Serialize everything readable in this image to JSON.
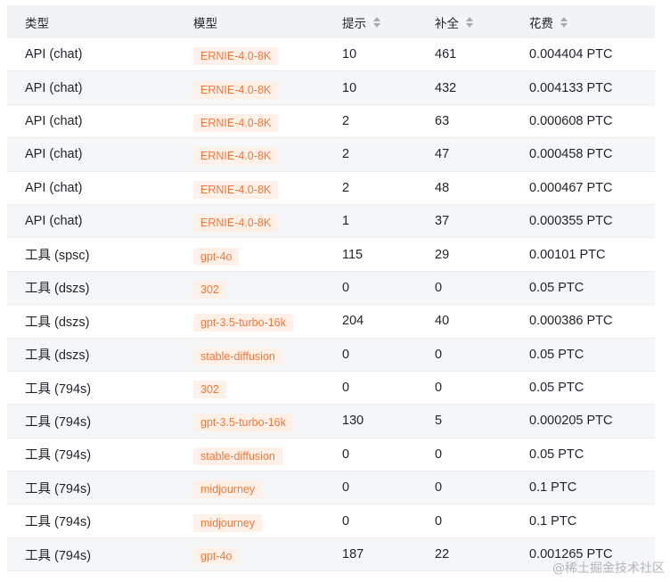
{
  "header": {
    "col_type": "类型",
    "col_model": "模型",
    "col_prompt": "提示",
    "col_completion": "补全",
    "col_cost": "花费"
  },
  "rows": [
    {
      "type": "API (chat)",
      "model": "ERNIE-4.0-8K",
      "prompt": "10",
      "completion": "461",
      "cost": "0.004404 PTC"
    },
    {
      "type": "API (chat)",
      "model": "ERNIE-4.0-8K",
      "prompt": "10",
      "completion": "432",
      "cost": "0.004133 PTC"
    },
    {
      "type": "API (chat)",
      "model": "ERNIE-4.0-8K",
      "prompt": "2",
      "completion": "63",
      "cost": "0.000608 PTC"
    },
    {
      "type": "API (chat)",
      "model": "ERNIE-4.0-8K",
      "prompt": "2",
      "completion": "47",
      "cost": "0.000458 PTC"
    },
    {
      "type": "API (chat)",
      "model": "ERNIE-4.0-8K",
      "prompt": "2",
      "completion": "48",
      "cost": "0.000467 PTC"
    },
    {
      "type": "API (chat)",
      "model": "ERNIE-4.0-8K",
      "prompt": "1",
      "completion": "37",
      "cost": "0.000355 PTC"
    },
    {
      "type": "工具 (spsc)",
      "model": "gpt-4o",
      "prompt": "115",
      "completion": "29",
      "cost": "0.00101 PTC"
    },
    {
      "type": "工具 (dszs)",
      "model": "302",
      "prompt": "0",
      "completion": "0",
      "cost": "0.05 PTC"
    },
    {
      "type": "工具 (dszs)",
      "model": "gpt-3.5-turbo-16k",
      "prompt": "204",
      "completion": "40",
      "cost": "0.000386 PTC"
    },
    {
      "type": "工具 (dszs)",
      "model": "stable-diffusion",
      "prompt": "0",
      "completion": "0",
      "cost": "0.05 PTC"
    },
    {
      "type": "工具 (794s)",
      "model": "302",
      "prompt": "0",
      "completion": "0",
      "cost": "0.05 PTC"
    },
    {
      "type": "工具 (794s)",
      "model": "gpt-3.5-turbo-16k",
      "prompt": "130",
      "completion": "5",
      "cost": "0.000205 PTC"
    },
    {
      "type": "工具 (794s)",
      "model": "stable-diffusion",
      "prompt": "0",
      "completion": "0",
      "cost": "0.05 PTC"
    },
    {
      "type": "工具 (794s)",
      "model": "midjourney",
      "prompt": "0",
      "completion": "0",
      "cost": "0.1 PTC"
    },
    {
      "type": "工具 (794s)",
      "model": "midjourney",
      "prompt": "0",
      "completion": "0",
      "cost": "0.1 PTC"
    },
    {
      "type": "工具 (794s)",
      "model": "gpt-4o",
      "prompt": "187",
      "completion": "22",
      "cost": "0.001265 PTC"
    }
  ],
  "watermark": "@稀土掘金技术社区",
  "colors": {
    "tag_bg": "#fff1e8",
    "tag_text": "#f2773a",
    "header_bg": "#f2f3f5",
    "row_alt_bg": "#f5f6f7"
  }
}
